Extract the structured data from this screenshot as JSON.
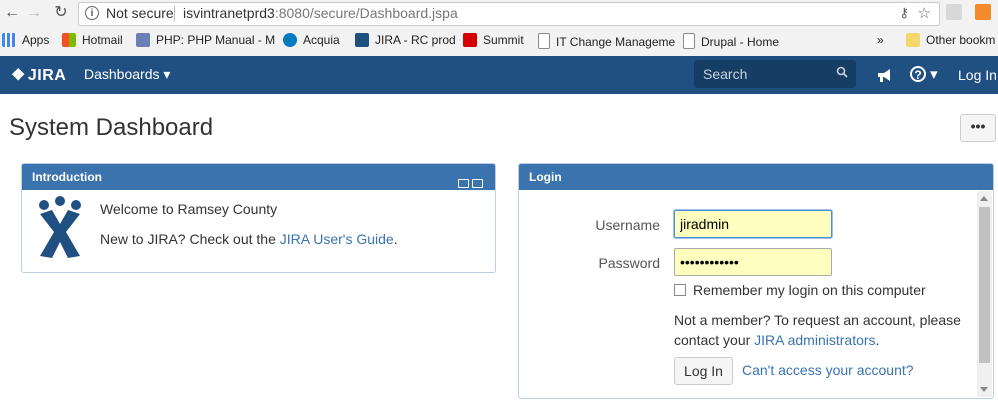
{
  "browser": {
    "security_label": "Not secure",
    "url_host": "isvintranetprd3",
    "url_rest": ":8080/secure/Dashboard.jspa",
    "bookmarks": [
      {
        "label": "Apps",
        "icon": "apps-grid-icon",
        "color": "#4285f4"
      },
      {
        "label": "Hotmail",
        "icon": "windows-icon",
        "color": "#f25022"
      },
      {
        "label": "PHP: PHP Manual - M",
        "icon": "php-icon",
        "color": "#6c7eb7"
      },
      {
        "label": "Acquia",
        "icon": "acquia-icon",
        "color": "#0678be"
      },
      {
        "label": "JIRA - RC prod",
        "icon": "jira-icon",
        "color": "#205081"
      },
      {
        "label": "Summit",
        "icon": "summit-icon",
        "color": "#d40000"
      },
      {
        "label": "IT Change Manageme",
        "icon": "page-icon",
        "color": "#888888"
      },
      {
        "label": "Drupal - Home",
        "icon": "page-icon",
        "color": "#888888"
      }
    ],
    "overflow": "»",
    "other_bookmarks": "Other bookm"
  },
  "header": {
    "logo": "JIRA",
    "dashboards_label": "Dashboards ▾",
    "search_placeholder": "Search",
    "help_caret": "▾",
    "login_label": "Log In",
    "brand_color": "#205081"
  },
  "page": {
    "title": "System Dashboard",
    "more_label": "•••"
  },
  "intro": {
    "title": "Introduction",
    "welcome": "Welcome to Ramsey County",
    "new_prefix": "New to JIRA? Check out the ",
    "guide_link": "JIRA User's Guide",
    "new_suffix": "."
  },
  "login": {
    "title": "Login",
    "username_label": "Username",
    "username_value": "jiradmin",
    "password_label": "Password",
    "password_value": "••••••••••••",
    "remember_label": "Remember my login on this computer",
    "not_member_text": "Not a member? To request an account, please contact your ",
    "admins_link": "JIRA administrators",
    "not_member_suffix": ".",
    "login_button": "Log In",
    "cant_access": "Can't access your account?"
  }
}
